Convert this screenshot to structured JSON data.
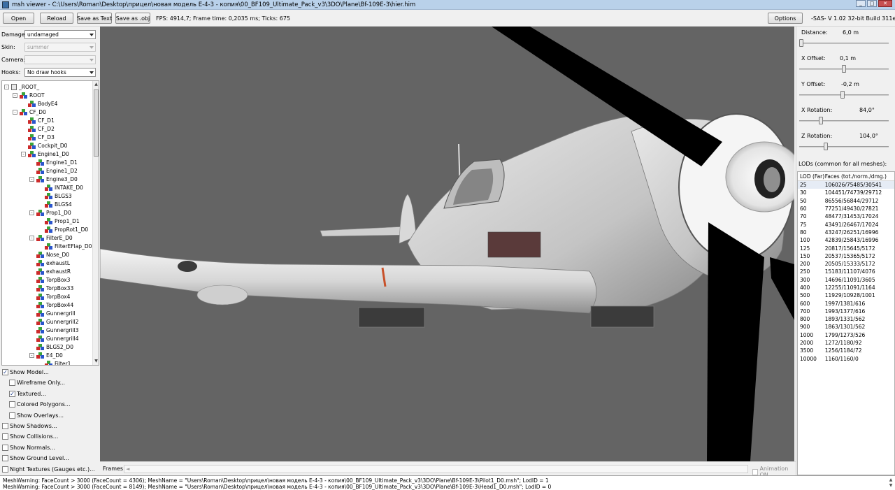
{
  "window": {
    "title": "msh viewer - C:\\Users\\Roman\\Desktop\\прицел\\новая модель E-4-3 - копия\\00_BF109_Ultimate_Pack_v3\\3DO\\Plane\\Bf-109E-3\\hier.him"
  },
  "toolbar": {
    "open": "Open",
    "reload": "Reload",
    "save_text": "Save as Text",
    "save_obj": "Save as .obj",
    "stats": "FPS: 4914,7; Frame time: 0,2035 ms; Ticks: 675",
    "options": "Options",
    "version": "-SAS- V 1.02  32-bit  Build 311e"
  },
  "left": {
    "damage_label": "Damage:",
    "damage_value": "undamaged",
    "skin_label": "Skin:",
    "skin_value": "summer",
    "camera_label": "Camera:",
    "camera_value": "",
    "hooks_label": "Hooks:",
    "hooks_value": "No draw hooks"
  },
  "tree": [
    {
      "label": "_ROOT_",
      "level": 0,
      "toggle": "-",
      "root": true
    },
    {
      "label": "ROOT",
      "level": 1,
      "toggle": "-"
    },
    {
      "label": "BodyE4",
      "level": 2,
      "toggle": ""
    },
    {
      "label": "CF_D0",
      "level": 1,
      "toggle": "-"
    },
    {
      "label": "CF_D1",
      "level": 2,
      "toggle": ""
    },
    {
      "label": "CF_D2",
      "level": 2,
      "toggle": ""
    },
    {
      "label": "CF_D3",
      "level": 2,
      "toggle": ""
    },
    {
      "label": "Cockpit_D0",
      "level": 2,
      "toggle": ""
    },
    {
      "label": "Engine1_D0",
      "level": 2,
      "toggle": "-"
    },
    {
      "label": "Engine1_D1",
      "level": 3,
      "toggle": ""
    },
    {
      "label": "Engine1_D2",
      "level": 3,
      "toggle": ""
    },
    {
      "label": "Engine3_D0",
      "level": 3,
      "toggle": "-"
    },
    {
      "label": "INTAKE_D0",
      "level": 4,
      "toggle": ""
    },
    {
      "label": "BLGS3",
      "level": 4,
      "toggle": ""
    },
    {
      "label": "BLGS4",
      "level": 4,
      "toggle": ""
    },
    {
      "label": "Prop1_D0",
      "level": 3,
      "toggle": "-"
    },
    {
      "label": "Prop1_D1",
      "level": 4,
      "toggle": ""
    },
    {
      "label": "PropRot1_D0",
      "level": 4,
      "toggle": ""
    },
    {
      "label": "FilterE_D0",
      "level": 3,
      "toggle": "-"
    },
    {
      "label": "FilterEFlap_D0",
      "level": 4,
      "toggle": ""
    },
    {
      "label": "Nose_D0",
      "level": 3,
      "toggle": ""
    },
    {
      "label": "exhaustL",
      "level": 3,
      "toggle": ""
    },
    {
      "label": "exhaustR",
      "level": 3,
      "toggle": ""
    },
    {
      "label": "TorpBox3",
      "level": 3,
      "toggle": ""
    },
    {
      "label": "TorpBox33",
      "level": 3,
      "toggle": ""
    },
    {
      "label": "TorpBox4",
      "level": 3,
      "toggle": ""
    },
    {
      "label": "TorpBox44",
      "level": 3,
      "toggle": ""
    },
    {
      "label": "Gunnergrill",
      "level": 3,
      "toggle": ""
    },
    {
      "label": "Gunnergrill2",
      "level": 3,
      "toggle": ""
    },
    {
      "label": "Gunnergrill3",
      "level": 3,
      "toggle": ""
    },
    {
      "label": "Gunnergrill4",
      "level": 3,
      "toggle": ""
    },
    {
      "label": "BLGS2_D0",
      "level": 3,
      "toggle": ""
    },
    {
      "label": "E4_D0",
      "level": 3,
      "toggle": "-"
    },
    {
      "label": "Filter1",
      "level": 4,
      "toggle": ""
    }
  ],
  "options": [
    {
      "label": "Show Model...",
      "checked": true,
      "indent": 0
    },
    {
      "label": "Wireframe Only...",
      "checked": false,
      "indent": 1
    },
    {
      "label": "Textured...",
      "checked": true,
      "indent": 1
    },
    {
      "label": "Colored Polygons...",
      "checked": false,
      "indent": 1
    },
    {
      "label": "Show Overlays...",
      "checked": false,
      "indent": 1
    },
    {
      "label": "Show Shadows...",
      "checked": false,
      "indent": 0
    },
    {
      "label": "Show Collisions...",
      "checked": false,
      "indent": 0
    },
    {
      "label": "Show Normals...",
      "checked": false,
      "indent": 0
    },
    {
      "label": "Show Ground Level...",
      "checked": false,
      "indent": 0
    },
    {
      "label": "Night Textures (Gauges etc.)...",
      "checked": false,
      "indent": 0
    }
  ],
  "check_mark": "✓",
  "frames": {
    "label": "Frames:",
    "arrow": "◄",
    "animation": "Animation ON"
  },
  "right": {
    "sliders": [
      {
        "label": "Distance:",
        "value": "6,0 m",
        "pos": 0.0
      },
      {
        "label": "X Offset:",
        "value": "0,1 m",
        "pos": 0.5
      },
      {
        "label": "Y Offset:",
        "value": "-0,2 m",
        "pos": 0.48
      },
      {
        "label": "X Rotation:",
        "value": "84,0°",
        "pos": 0.23
      },
      {
        "label": "Z Rotation:",
        "value": "104,0°",
        "pos": 0.29
      }
    ],
    "lods_title": "LODs (common for all meshes):",
    "lod_head": [
      "LOD (Far)",
      "Faces (tot./norm./dmg.)"
    ],
    "lods": [
      [
        "25",
        "106026/75485/30541"
      ],
      [
        "30",
        "104451/74739/29712"
      ],
      [
        "50",
        "86556/56844/29712"
      ],
      [
        "60",
        "77251/49430/27821"
      ],
      [
        "70",
        "48477/31453/17024"
      ],
      [
        "75",
        "43491/26467/17024"
      ],
      [
        "80",
        "43247/26251/16996"
      ],
      [
        "100",
        "42839/25843/16996"
      ],
      [
        "125",
        "20817/15645/5172"
      ],
      [
        "150",
        "20537/15365/5172"
      ],
      [
        "200",
        "20505/15333/5172"
      ],
      [
        "250",
        "15183/11107/4076"
      ],
      [
        "300",
        "14696/11091/3605"
      ],
      [
        "400",
        "12255/11091/1164"
      ],
      [
        "500",
        "11929/10928/1001"
      ],
      [
        "600",
        "1997/1381/616"
      ],
      [
        "700",
        "1993/1377/616"
      ],
      [
        "800",
        "1893/1331/562"
      ],
      [
        "900",
        "1863/1301/562"
      ],
      [
        "1000",
        "1799/1273/526"
      ],
      [
        "2000",
        "1272/1180/92"
      ],
      [
        "3500",
        "1256/1184/72"
      ],
      [
        "10000",
        "1160/1160/0"
      ]
    ]
  },
  "log": [
    "MeshWarning: FaceCount > 3000 (FaceCount = 4306); MeshName = \"Users\\Roman\\Desktop\\прицел\\новая модель E-4-3 - копия\\00_BF109_Ultimate_Pack_v3\\3DO\\Plane\\Bf-109E-3\\Pilot1_D0.msh\"; LodID = 1",
    "MeshWarning: FaceCount > 3000 (FaceCount = 8149); MeshName = \"Users\\Roman\\Desktop\\прицел\\новая модель E-4-3 - копия\\00_BF109_Ultimate_Pack_v3\\3DO\\Plane\\Bf-109E-3\\Head1_D0.msh\"; LodID = 0"
  ],
  "colors": {
    "viewport": "#646464",
    "selection": "#e6ecf5",
    "titlebar": "#b9d1ea"
  }
}
